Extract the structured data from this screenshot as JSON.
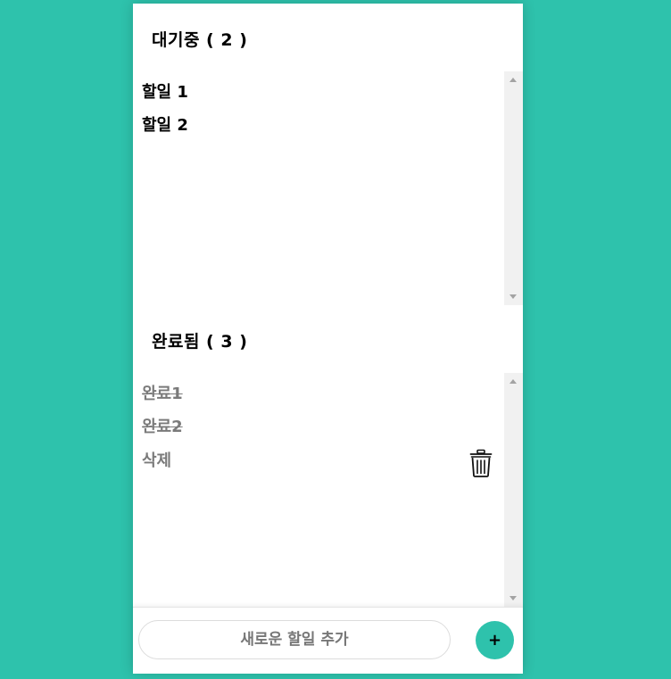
{
  "pending": {
    "title": "대기중 ( 2 )",
    "items": [
      {
        "label": "할일 1"
      },
      {
        "label": "할일 2"
      }
    ]
  },
  "done": {
    "title": "완료됨 ( 3 )",
    "items": [
      {
        "label": "완료1",
        "strikethrough": true
      },
      {
        "label": "완료2",
        "strikethrough": true
      },
      {
        "label": "삭제",
        "strikethrough": false,
        "has_delete_icon": true
      }
    ]
  },
  "footer": {
    "input_placeholder": "새로운 할일 추가",
    "input_value": "",
    "add_button_label": "+"
  },
  "icons": {
    "delete": "trash-icon",
    "scroll_up": "scroll-up-arrow-icon",
    "scroll_down": "scroll-down-arrow-icon"
  },
  "colors": {
    "background": "#2ec2ac",
    "accent": "#2ec2ac",
    "panel": "#ffffff",
    "done_text": "#7a7a7a",
    "pending_text": "#000000"
  }
}
